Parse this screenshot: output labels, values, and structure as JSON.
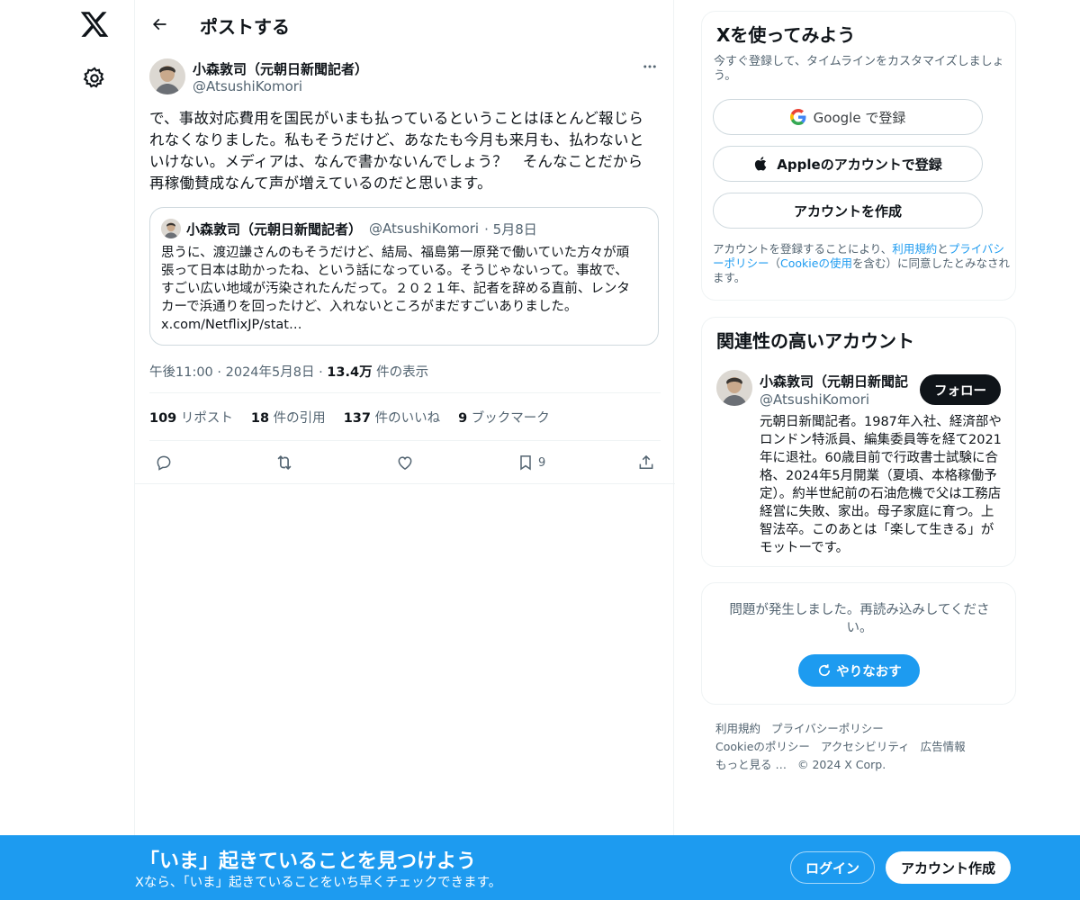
{
  "nav": {
    "logo_icon": "x-logo-icon",
    "settings_icon": "gear-icon"
  },
  "header": {
    "title": "ポストする",
    "back_icon": "arrow-left-icon"
  },
  "post": {
    "author_name": "小森敦司（元朝日新聞記者）",
    "author_handle": "@AtsushiKomori",
    "text": "で、事故対応費用を国民がいまも払っているということはほとんど報じら\nれなくなりました。私もそうだけど、あなたも今月も来月も、払わないと\nいけない。メディアは、なんで書かないんでしょう？　そんなことだから\n再稼働賛成なんて声が増えているのだと思います。",
    "quote": {
      "author_name": "小森敦司（元朝日新聞記者）",
      "author_handle": "@AtsushiKomori",
      "date": "· 5月8日",
      "text": "思うに、渡辺謙さんのもそうだけど、結局、福島第一原発で働いていた方々が頑\n張って日本は助かったね、という話になっている。そうじゃないって。事故で、\nすごい広い地域が汚染されたんだって。２０２１年、記者を辞める直前、レンタ\nカーで浜通りを回ったけど、入れないところがまだすごいありました。\nx.com/NetflixJP/stat…"
    },
    "time": "午後11:00 · 2024年5月8日 · ",
    "views_count": "13.4万",
    "views_label": " 件の表示",
    "stats": [
      {
        "count": "109",
        "label": " リポスト"
      },
      {
        "count": "18",
        "label": " 件の引用"
      },
      {
        "count": "137",
        "label": " 件のいいね"
      },
      {
        "count": "9",
        "label": " ブックマーク"
      }
    ],
    "bookmark_count": "9"
  },
  "signup_card": {
    "title": "Xを使ってみよう",
    "subtitle": "今すぐ登録して、タイムラインをカスタマイズしましょう。",
    "google_label": "Google で登録",
    "apple_label": "Appleのアカウントで登録",
    "create_label": "アカウントを作成",
    "legal_1": "アカウントを登録することにより、",
    "legal_terms": "利用規約",
    "legal_2": "と",
    "legal_privacy": "プライバシーポリシー",
    "legal_3": "（",
    "legal_cookie": "Cookieの使用",
    "legal_4": "を含む）に同意したとみなされます。"
  },
  "related_card": {
    "title": "関連性の高いアカウント",
    "name": "小森敦司（元朝日新聞記",
    "handle": "@AtsushiKomori",
    "follow_label": "フォロー",
    "bio": "元朝日新聞記者。1987年入社、経済部やロンドン特派員、編集委員等を経て2021年に退社。60歳目前で行政書士試験に合格、2024年5月開業（夏頃、本格稼働予定）。約半世紀前の石油危機で父は工務店経営に失敗、家出。母子家庭に育つ。上智法卒。このあとは「楽して生きる」がモットーです。"
  },
  "error_card": {
    "message": "問題が発生しました。再読み込みしてください。",
    "retry_label": "やりなおす"
  },
  "footer": {
    "links": [
      "利用規約",
      "プライバシーポリシー",
      "Cookieのポリシー",
      "アクセシビリティ",
      "広告情報",
      "もっと見る …"
    ],
    "copyright": "© 2024 X Corp."
  },
  "banner": {
    "title": "「いま」起きていることを見つけよう",
    "subtitle": "Xなら、「いま」起きていることをいち早くチェックできます。",
    "login_label": "ログイン",
    "signup_label": "アカウント作成"
  },
  "colors": {
    "accent": "#1d9bf0",
    "text": "#0f1419",
    "secondary": "#536471",
    "border": "#eff3f4"
  }
}
